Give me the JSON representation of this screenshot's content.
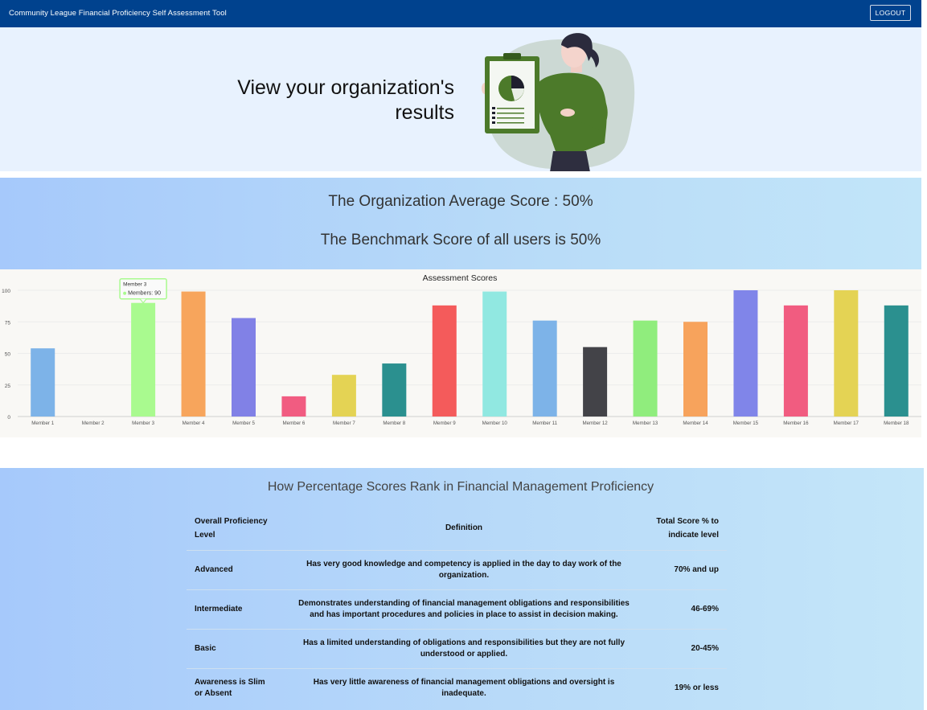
{
  "app": {
    "title": "Community League Financial Proficiency Self Assessment Tool",
    "logout_label": "LOGOUT"
  },
  "hero": {
    "heading_line1": "View your organization's",
    "heading_line2": "results",
    "illustration": "woman-holding-pie-chart-clipboard"
  },
  "scores": {
    "organization_average": "The Organization Average Score : 50%",
    "benchmark": "The Benchmark Score of all users is 50%"
  },
  "chart_data": {
    "type": "bar",
    "title": "Assessment Scores",
    "xlabel": "",
    "ylabel": "",
    "ylim": [
      0,
      100
    ],
    "yticks": [
      0,
      25,
      50,
      75,
      100
    ],
    "grid": true,
    "categories": [
      "Member 1",
      "Member 2",
      "Member 3",
      "Member 4",
      "Member 5",
      "Member 6",
      "Member 7",
      "Member 8",
      "Member 9",
      "Member 10",
      "Member 11",
      "Member 12",
      "Member 13",
      "Member 14",
      "Member 15",
      "Member 16",
      "Member 17",
      "Member 18"
    ],
    "values": [
      54,
      0,
      90,
      99,
      78,
      16,
      33,
      42,
      88,
      99,
      76,
      55,
      76,
      75,
      100,
      88,
      100,
      88
    ],
    "colors": [
      "#7db3e8",
      "#7db3e8",
      "#a9fa8f",
      "#f7a55c",
      "#8181e6",
      "#f15c81",
      "#e4d354",
      "#2b908f",
      "#f45b5b",
      "#91e8e1",
      "#7db3e8",
      "#434348",
      "#90ed7d",
      "#f7a35c",
      "#8085e9",
      "#f15c80",
      "#e4d354",
      "#2b908f"
    ],
    "tooltip": {
      "title": "Member 3",
      "series_label": "Members: 90"
    }
  },
  "ranks": {
    "heading": "How Percentage Scores Rank in Financial Management Proficiency",
    "columns": [
      "Overall Proficiency Level",
      "Definition",
      "Total Score % to indicate level"
    ],
    "rows": [
      {
        "level": "Advanced",
        "definition": "Has very good knowledge and competency is applied in the day to day work of the organization.",
        "score": "70% and up"
      },
      {
        "level": "Intermediate",
        "definition": "Demonstrates understanding of financial management obligations and responsibilities and has important procedures and policies in place to assist in decision making.",
        "score": "46-69%"
      },
      {
        "level": "Basic",
        "definition": "Has a limited understanding of obligations and responsibilities but they are not fully understood or applied.",
        "score": "20-45%"
      },
      {
        "level": "Awareness is Slim or Absent",
        "definition": "Has very little awareness of financial management obligations and oversight is inadequate.",
        "score": "19% or less"
      }
    ]
  }
}
